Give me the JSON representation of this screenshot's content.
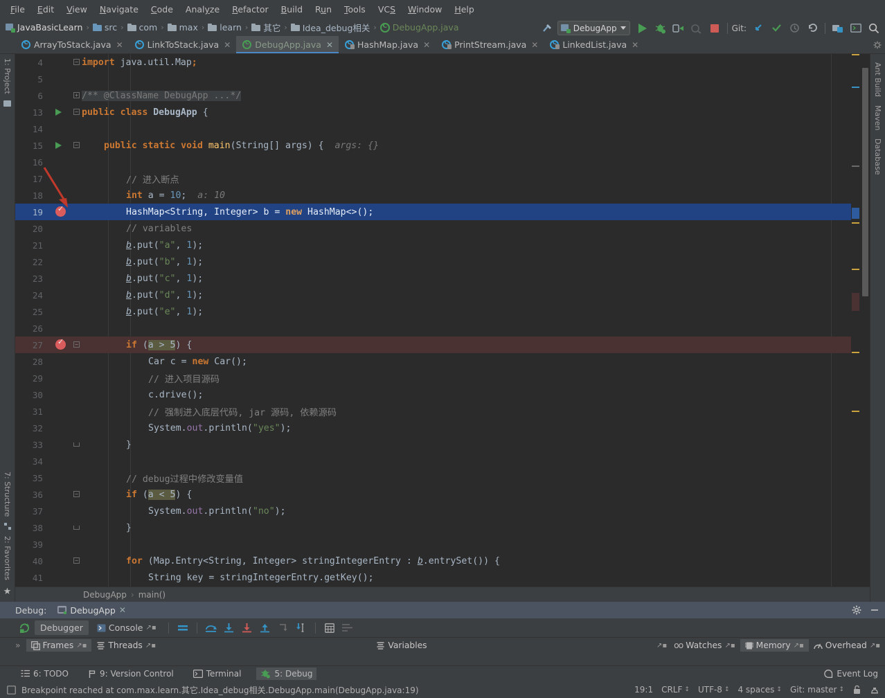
{
  "menu": {
    "items": [
      {
        "label": "File",
        "mnemonic": "F"
      },
      {
        "label": "Edit",
        "mnemonic": "E"
      },
      {
        "label": "View",
        "mnemonic": "V"
      },
      {
        "label": "Navigate",
        "mnemonic": "N"
      },
      {
        "label": "Code",
        "mnemonic": "C"
      },
      {
        "label": "Analyze",
        "mnemonic": "y"
      },
      {
        "label": "Refactor",
        "mnemonic": "R"
      },
      {
        "label": "Build",
        "mnemonic": "B"
      },
      {
        "label": "Run",
        "mnemonic": "u"
      },
      {
        "label": "Tools",
        "mnemonic": "T"
      },
      {
        "label": "VCS",
        "mnemonic": "S"
      },
      {
        "label": "Window",
        "mnemonic": "W"
      },
      {
        "label": "Help",
        "mnemonic": "H"
      }
    ]
  },
  "breadcrumb": {
    "items": [
      {
        "label": "JavaBasicLearn",
        "icon": "module-icon"
      },
      {
        "label": "src",
        "icon": "source-folder-icon"
      },
      {
        "label": "com",
        "icon": "folder-icon"
      },
      {
        "label": "max",
        "icon": "folder-icon"
      },
      {
        "label": "learn",
        "icon": "folder-icon"
      },
      {
        "label": "其它",
        "icon": "folder-icon"
      },
      {
        "label": "Idea_debug相关",
        "icon": "folder-icon"
      },
      {
        "label": "DebugApp.java",
        "icon": "java-class-icon"
      }
    ]
  },
  "toolbar": {
    "run_config": "DebugApp",
    "git_label": "Git:",
    "buttons": [
      {
        "name": "build-hammer-button"
      },
      {
        "name": "run-button"
      },
      {
        "name": "debug-button"
      },
      {
        "name": "run-with-coverage-button"
      },
      {
        "name": "profile-button"
      },
      {
        "name": "stop-button"
      },
      {
        "name": "git-update-button"
      },
      {
        "name": "git-commit-button"
      },
      {
        "name": "git-history-button"
      },
      {
        "name": "git-rollback-button"
      },
      {
        "name": "settings-button"
      },
      {
        "name": "project-structure-button"
      },
      {
        "name": "search-everywhere-button"
      }
    ]
  },
  "tabs": [
    {
      "label": "ArrayToStack.java",
      "active": false,
      "kind": "class"
    },
    {
      "label": "LinkToStack.java",
      "active": false,
      "kind": "class"
    },
    {
      "label": "DebugApp.java",
      "active": true,
      "kind": "class-green"
    },
    {
      "label": "HashMap.java",
      "active": false,
      "kind": "library"
    },
    {
      "label": "PrintStream.java",
      "active": false,
      "kind": "library"
    },
    {
      "label": "LinkedList.java",
      "active": false,
      "kind": "library"
    }
  ],
  "left_rail": {
    "top": [
      {
        "label": "1: Project"
      }
    ],
    "bottom": [
      {
        "label": "7: Structure"
      },
      {
        "label": "2: Favorites"
      }
    ]
  },
  "right_rail": [
    {
      "label": "Ant Build"
    },
    {
      "label": "Maven"
    },
    {
      "label": "Database"
    }
  ],
  "editor": {
    "lines": [
      {
        "num": "4",
        "indent": 0,
        "fold": "minus",
        "tokens": [
          {
            "t": "import ",
            "c": "kw"
          },
          {
            "t": "java.util.Map",
            "c": "plain"
          },
          {
            "t": ";",
            "c": "kw"
          }
        ]
      },
      {
        "num": "5",
        "indent": 0,
        "tokens": []
      },
      {
        "num": "6",
        "indent": 0,
        "fold": "plus",
        "doc": true,
        "tokens": [
          {
            "t": "/** @ClassName DebugApp ...*/",
            "c": "doc"
          }
        ]
      },
      {
        "num": "13",
        "indent": 0,
        "gutter": "run",
        "fold": "minus",
        "tokens": [
          {
            "t": "public ",
            "c": "kw"
          },
          {
            "t": "class ",
            "c": "kw"
          },
          {
            "t": "DebugApp",
            "c": "cls-b"
          },
          {
            "t": " {",
            "c": "plain"
          }
        ]
      },
      {
        "num": "14",
        "indent": 0,
        "tokens": []
      },
      {
        "num": "15",
        "indent": 1,
        "gutter": "run",
        "fold": "minus",
        "tokens": [
          {
            "t": "public ",
            "c": "kw"
          },
          {
            "t": "static ",
            "c": "kw"
          },
          {
            "t": "void ",
            "c": "kw"
          },
          {
            "t": "main",
            "c": "mth"
          },
          {
            "t": "(String[] args) {",
            "c": "plain"
          },
          {
            "t": "  args: {}",
            "c": "hint"
          }
        ]
      },
      {
        "num": "16",
        "indent": 1,
        "tokens": []
      },
      {
        "num": "17",
        "indent": 2,
        "tokens": [
          {
            "t": "// 进入断点",
            "c": "cmt"
          }
        ]
      },
      {
        "num": "18",
        "indent": 2,
        "tokens": [
          {
            "t": "int ",
            "c": "kw"
          },
          {
            "t": "a = ",
            "c": "plain"
          },
          {
            "t": "10",
            "c": "num"
          },
          {
            "t": ";",
            "c": "plain"
          },
          {
            "t": "  a: 10",
            "c": "hint"
          }
        ]
      },
      {
        "num": "19",
        "indent": 2,
        "gutter": "breakpoint",
        "highlight": true,
        "tokens": [
          {
            "t": "HashMap<String, Integer> b = ",
            "c": "plain"
          },
          {
            "t": "new ",
            "c": "kw"
          },
          {
            "t": "HashMap<>();",
            "c": "plain"
          }
        ]
      },
      {
        "num": "20",
        "indent": 2,
        "tokens": [
          {
            "t": "// variables",
            "c": "cmt"
          }
        ]
      },
      {
        "num": "21",
        "indent": 2,
        "tokens": [
          {
            "t": "b",
            "c": "stat"
          },
          {
            "t": ".put(",
            "c": "plain"
          },
          {
            "t": "\"a\"",
            "c": "str"
          },
          {
            "t": ", ",
            "c": "plain"
          },
          {
            "t": "1",
            "c": "num"
          },
          {
            "t": ");",
            "c": "plain"
          }
        ]
      },
      {
        "num": "22",
        "indent": 2,
        "tokens": [
          {
            "t": "b",
            "c": "stat"
          },
          {
            "t": ".put(",
            "c": "plain"
          },
          {
            "t": "\"b\"",
            "c": "str"
          },
          {
            "t": ", ",
            "c": "plain"
          },
          {
            "t": "1",
            "c": "num"
          },
          {
            "t": ");",
            "c": "plain"
          }
        ]
      },
      {
        "num": "23",
        "indent": 2,
        "tokens": [
          {
            "t": "b",
            "c": "stat"
          },
          {
            "t": ".put(",
            "c": "plain"
          },
          {
            "t": "\"c\"",
            "c": "str"
          },
          {
            "t": ", ",
            "c": "plain"
          },
          {
            "t": "1",
            "c": "num"
          },
          {
            "t": ");",
            "c": "plain"
          }
        ]
      },
      {
        "num": "24",
        "indent": 2,
        "tokens": [
          {
            "t": "b",
            "c": "stat"
          },
          {
            "t": ".put(",
            "c": "plain"
          },
          {
            "t": "\"d\"",
            "c": "str"
          },
          {
            "t": ", ",
            "c": "plain"
          },
          {
            "t": "1",
            "c": "num"
          },
          {
            "t": ");",
            "c": "plain"
          }
        ]
      },
      {
        "num": "25",
        "indent": 2,
        "tokens": [
          {
            "t": "b",
            "c": "stat"
          },
          {
            "t": ".put(",
            "c": "plain"
          },
          {
            "t": "\"e\"",
            "c": "str"
          },
          {
            "t": ", ",
            "c": "plain"
          },
          {
            "t": "1",
            "c": "num"
          },
          {
            "t": ");",
            "c": "plain"
          }
        ]
      },
      {
        "num": "26",
        "indent": 2,
        "tokens": []
      },
      {
        "num": "27",
        "indent": 2,
        "gutter": "breakpoint",
        "bpline": true,
        "fold": "minus",
        "tokens": [
          {
            "t": "if ",
            "c": "kw"
          },
          {
            "t": "(",
            "c": "plain"
          },
          {
            "t": "a > 5",
            "c": "seltok"
          },
          {
            "t": ") {",
            "c": "plain"
          }
        ]
      },
      {
        "num": "28",
        "indent": 3,
        "tokens": [
          {
            "t": "Car c = ",
            "c": "plain"
          },
          {
            "t": "new ",
            "c": "kw"
          },
          {
            "t": "Car();",
            "c": "plain"
          }
        ]
      },
      {
        "num": "29",
        "indent": 3,
        "tokens": [
          {
            "t": "// 进入项目源码",
            "c": "cmt"
          }
        ]
      },
      {
        "num": "30",
        "indent": 3,
        "tokens": [
          {
            "t": "c.drive();",
            "c": "plain"
          }
        ]
      },
      {
        "num": "31",
        "indent": 3,
        "tokens": [
          {
            "t": "// 强制进入底层代码, jar 源码, 依赖源码",
            "c": "cmt"
          }
        ]
      },
      {
        "num": "32",
        "indent": 3,
        "tokens": [
          {
            "t": "System.",
            "c": "plain"
          },
          {
            "t": "out",
            "c": "fld"
          },
          {
            "t": ".println(",
            "c": "plain"
          },
          {
            "t": "\"yes\"",
            "c": "str"
          },
          {
            "t": ");",
            "c": "plain"
          }
        ]
      },
      {
        "num": "33",
        "indent": 2,
        "fold": "end",
        "tokens": [
          {
            "t": "}",
            "c": "plain"
          }
        ]
      },
      {
        "num": "34",
        "indent": 2,
        "tokens": []
      },
      {
        "num": "35",
        "indent": 2,
        "tokens": [
          {
            "t": "// debug过程中修改变量值",
            "c": "cmt"
          }
        ]
      },
      {
        "num": "36",
        "indent": 2,
        "fold": "minus",
        "tokens": [
          {
            "t": "if ",
            "c": "kw"
          },
          {
            "t": "(",
            "c": "plain"
          },
          {
            "t": "a < 5",
            "c": "seltok"
          },
          {
            "t": ") {",
            "c": "plain"
          }
        ]
      },
      {
        "num": "37",
        "indent": 3,
        "tokens": [
          {
            "t": "System.",
            "c": "plain"
          },
          {
            "t": "out",
            "c": "fld"
          },
          {
            "t": ".println(",
            "c": "plain"
          },
          {
            "t": "\"no\"",
            "c": "str"
          },
          {
            "t": ");",
            "c": "plain"
          }
        ]
      },
      {
        "num": "38",
        "indent": 2,
        "fold": "end",
        "tokens": [
          {
            "t": "}",
            "c": "plain"
          }
        ]
      },
      {
        "num": "39",
        "indent": 2,
        "tokens": []
      },
      {
        "num": "40",
        "indent": 2,
        "fold": "minus",
        "tokens": [
          {
            "t": "for ",
            "c": "kw"
          },
          {
            "t": "(Map.Entry<String, Integer> stringIntegerEntry : ",
            "c": "plain"
          },
          {
            "t": "b",
            "c": "stat"
          },
          {
            "t": ".entrySet()) {",
            "c": "plain"
          }
        ]
      },
      {
        "num": "41",
        "indent": 3,
        "tokens": [
          {
            "t": "String key = stringIntegerEntry.getKey();",
            "c": "plain"
          }
        ]
      }
    ],
    "crumb": [
      "DebugApp",
      "main()"
    ]
  },
  "debug_panel": {
    "title": "Debug:",
    "session_tab": "DebugApp",
    "tabs": [
      {
        "label": "Debugger",
        "selected": true
      },
      {
        "label": "Console",
        "selected": false
      }
    ],
    "toolbar_icons": [
      {
        "name": "rerun-button"
      },
      {
        "name": "mute-breakpoints-button"
      },
      {
        "name": "step-over-button"
      },
      {
        "name": "step-into-button"
      },
      {
        "name": "force-step-into-button"
      },
      {
        "name": "step-out-button"
      },
      {
        "name": "drop-frame-button"
      },
      {
        "name": "run-to-cursor-button"
      },
      {
        "name": "evaluate-expression-button"
      },
      {
        "name": "settings-list-button"
      }
    ],
    "sub_tabs": [
      {
        "label": "Frames",
        "selected": true
      },
      {
        "label": "Threads",
        "selected": false
      },
      {
        "label": "Variables",
        "selected": false
      },
      {
        "label": "Watches",
        "selected": false
      },
      {
        "label": "Memory",
        "selected": true
      },
      {
        "label": "Overhead",
        "selected": false
      }
    ],
    "settings_icon": "gear-icon",
    "minimize_icon": "minimize-icon"
  },
  "bottom_bar": {
    "items": [
      {
        "label": "6: TODO",
        "mnemonic": "6",
        "selected": false
      },
      {
        "label": "9: Version Control",
        "mnemonic": "9",
        "selected": false
      },
      {
        "label": "Terminal",
        "mnemonic": "",
        "selected": false
      },
      {
        "label": "5: Debug",
        "mnemonic": "5",
        "selected": true
      }
    ],
    "event_log": "Event Log"
  },
  "status_bar": {
    "message": "Breakpoint reached at com.max.learn.其它.Idea_debug相关.DebugApp.main(DebugApp.java:19)",
    "caret": "19:1",
    "line_sep": "CRLF",
    "encoding": "UTF-8",
    "indent": "4 spaces",
    "branch": "Git: master"
  },
  "colors": {
    "accent_blue": "#4a88c7",
    "selection": "#214283",
    "breakpoint_red": "#db5c5c",
    "breakpoint_line": "#4b3232",
    "panel_bg": "#3c3f41",
    "editor_bg": "#2b2b2b",
    "keyword": "#cc7832",
    "string": "#6a8759",
    "number": "#6897bb",
    "comment": "#808080",
    "method": "#ffc66d",
    "field": "#9876aa"
  }
}
